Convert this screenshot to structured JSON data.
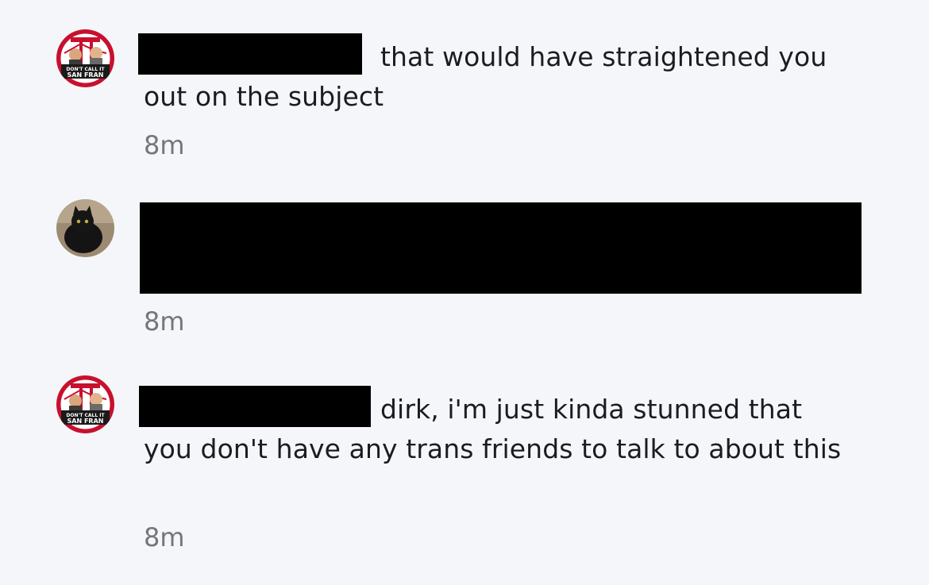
{
  "comments": [
    {
      "text": "that would have straightened you out on the subject",
      "time": "8m",
      "avatar_icon": "podcast-logo-avatar-icon",
      "avatar_caption": "DON'T CALL IT SAN FRAN"
    },
    {
      "text": "",
      "time": "8m",
      "avatar_icon": "black-cat-avatar-icon"
    },
    {
      "text": "dirk, i'm just kinda stunned that you don't have any trans friends to talk to about this",
      "time": "8m",
      "avatar_icon": "podcast-logo-avatar-icon",
      "avatar_caption": "DON'T CALL IT SAN FRAN"
    }
  ],
  "colors": {
    "background": "#f4f6f9",
    "text": "#1c1c1f",
    "timestamp": "#74767b",
    "redaction": "#000000",
    "logo_red": "#c8102e"
  }
}
